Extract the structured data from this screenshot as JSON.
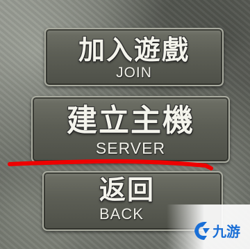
{
  "menu": {
    "join": {
      "label_cn": "加入遊戲",
      "label_en": "JOIN"
    },
    "server": {
      "label_cn": "建立主機",
      "label_en": "SERVER"
    },
    "back": {
      "label_cn": "返回",
      "label_en": "BACK"
    }
  },
  "annotation": {
    "color": "#ee0000"
  },
  "watermark": {
    "text": "九游",
    "color": "#1a6fd6",
    "icon": "jiuyou-logo-icon"
  }
}
